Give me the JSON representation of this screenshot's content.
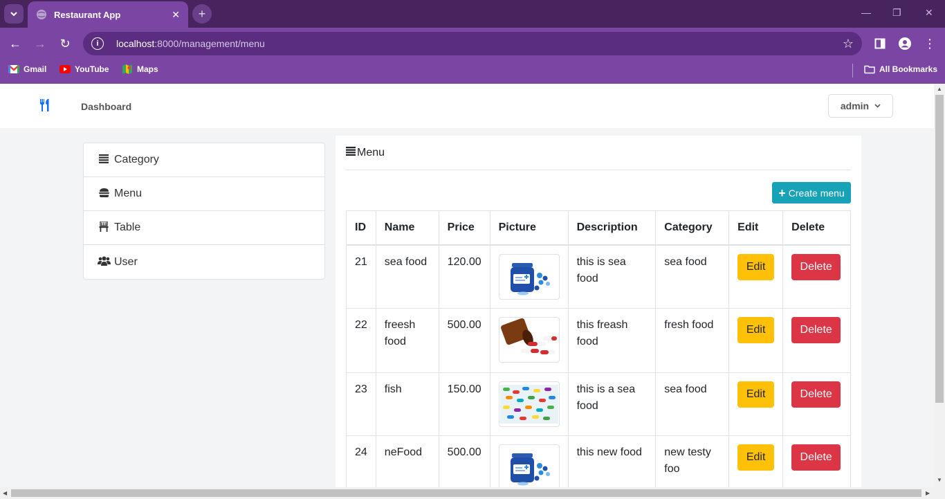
{
  "browser": {
    "tab_title": "Restaurant App",
    "tab_close": "✕",
    "new_tab": "+",
    "url_host": "localhost",
    "url_path": ":8000/management/menu",
    "bookmarks": [
      {
        "label": "Gmail"
      },
      {
        "label": "YouTube"
      },
      {
        "label": "Maps"
      }
    ],
    "all_bookmarks": "All Bookmarks"
  },
  "navbar": {
    "brand_icon": "utensils-icon",
    "dashboard": "Dashboard",
    "user": "admin"
  },
  "sidebar": {
    "items": [
      {
        "label": "Category",
        "icon": "list-icon"
      },
      {
        "label": "Menu",
        "icon": "burger-icon"
      },
      {
        "label": "Table",
        "icon": "chair-icon"
      },
      {
        "label": "User",
        "icon": "users-icon"
      }
    ]
  },
  "main": {
    "title": "Menu",
    "create_button": "Create menu",
    "columns": [
      "ID",
      "Name",
      "Price",
      "Picture",
      "Description",
      "Category",
      "Edit",
      "Delete"
    ],
    "rows": [
      {
        "id": "21",
        "name": "sea food",
        "price": "120.00",
        "picture": "pill-bottle-blue",
        "description": "this is sea food",
        "category": "sea food",
        "edit": "Edit",
        "delete": "Delete"
      },
      {
        "id": "22",
        "name": "freesh food",
        "price": "500.00",
        "picture": "pill-bottle-amber",
        "description": "this freash food",
        "category": "fresh food",
        "edit": "Edit",
        "delete": "Delete"
      },
      {
        "id": "23",
        "name": "fish",
        "price": "150.00",
        "picture": "colorful-pills",
        "description": "this is a sea food",
        "category": "sea food",
        "edit": "Edit",
        "delete": "Delete"
      },
      {
        "id": "24",
        "name": "neFood",
        "price": "500.00",
        "picture": "pill-bottle-blue",
        "description": "this new food",
        "category": "new testy foo",
        "edit": "Edit",
        "delete": "Delete"
      }
    ]
  },
  "colors": {
    "chrome_dark": "#48245f",
    "chrome": "#7a45a3",
    "primary": "#0d6efd",
    "info": "#17a2b8",
    "warning": "#ffc107",
    "danger": "#dc3545"
  }
}
